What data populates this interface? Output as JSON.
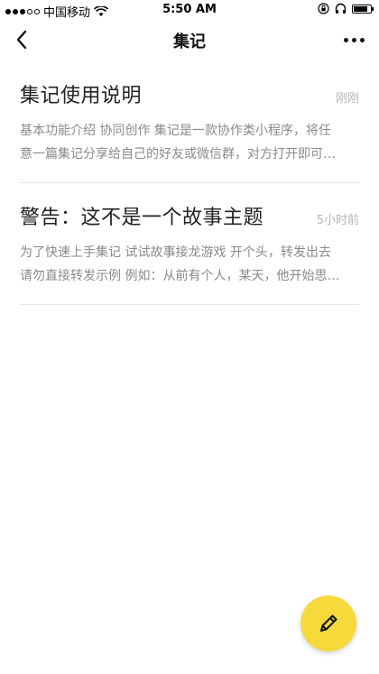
{
  "status_bar": {
    "carrier": "中国移动",
    "time": "5:50 AM",
    "signal_bars_filled": 3,
    "signal_bars_total": 5,
    "battery_level": 0.85
  },
  "nav": {
    "title": "集记"
  },
  "cards": [
    {
      "title": "集记使用说明",
      "time": "刚刚",
      "desc_line1": "基本功能介绍 协同创作 集记是一款协作类小程序，将任",
      "desc_line2": "意一篇集记分享给自己的好友或微信群，对方打开即可…"
    },
    {
      "title": "警告：这不是一个故事主题",
      "time": "5小时前",
      "desc_line1": "为了快速上手集记 试试故事接龙游戏 开个头，转发出去",
      "desc_line2": "请勿直接转发示例 例如：从前有个人，某天，他开始思…"
    }
  ],
  "fab": {
    "icon": "pencil-icon",
    "color": "#f6d93b"
  }
}
